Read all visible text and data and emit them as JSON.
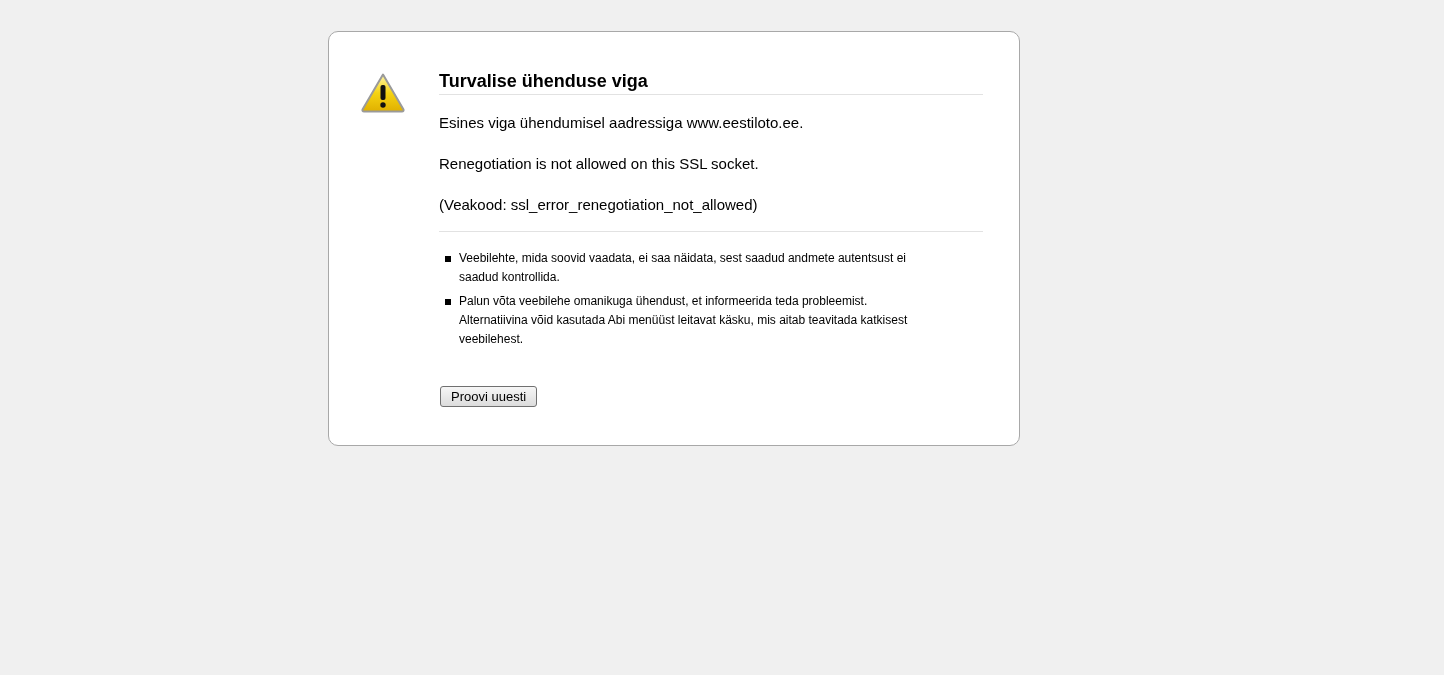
{
  "error_page": {
    "title": "Turvalise ühenduse viga",
    "paragraphs": [
      "Esines viga ühendumisel aadressiga www.eestiloto.ee.",
      "Renegotiation is not allowed on this SSL socket.",
      "(Veakood: ssl_error_renegotiation_not_allowed)"
    ],
    "details": [
      "Veebilehte, mida soovid vaadata, ei saa näidata, sest saadud andmete autentsust ei saadud kontrollida.",
      "Palun võta veebilehe omanikuga ühendust, et informeerida teda probleemist. Alternatiivina võid kasutada Abi menüüst leitavat käsku, mis aitab teavitada katkisest veebilehest."
    ],
    "button": "Proovi uuesti"
  }
}
